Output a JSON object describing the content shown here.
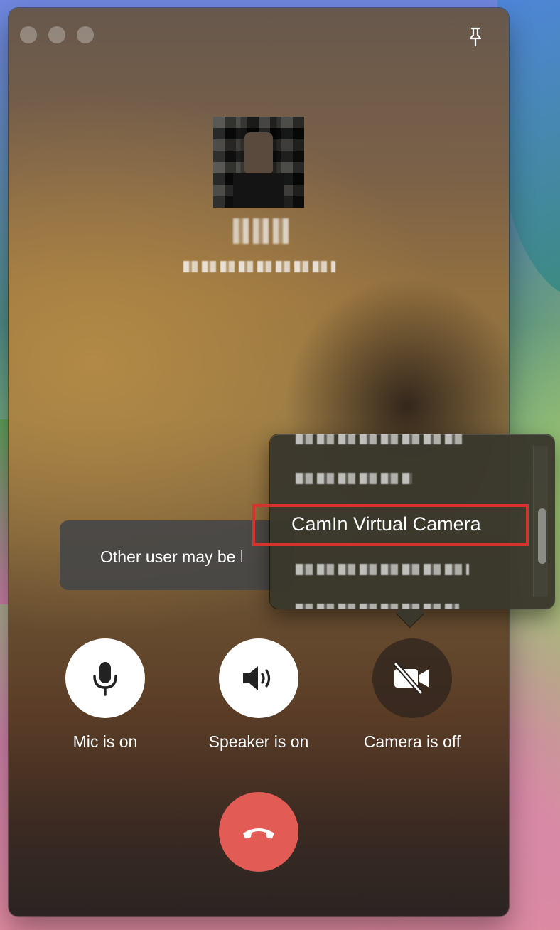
{
  "window": {
    "traffic_lights": [
      "close",
      "minimize",
      "zoom"
    ],
    "pin_icon": "pin-icon"
  },
  "caller": {
    "avatar": "profile-photo"
  },
  "toast": {
    "text": "Other user may be busy"
  },
  "controls": {
    "mic": {
      "label": "Mic is on",
      "icon": "microphone-icon"
    },
    "speaker": {
      "label": "Speaker is on",
      "icon": "speaker-icon"
    },
    "camera": {
      "label": "Camera is off",
      "icon": "video-off-icon"
    },
    "hangup": {
      "icon": "phone-hangup-icon",
      "color": "#e25b55"
    }
  },
  "camera_menu": {
    "highlighted_item": "CamIn Virtual Camera",
    "highlight_color": "#d7322c"
  }
}
